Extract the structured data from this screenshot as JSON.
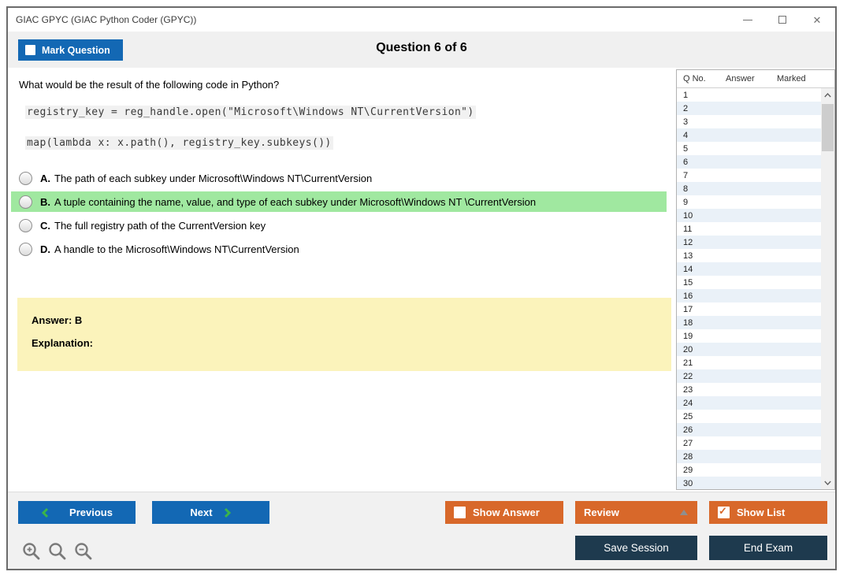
{
  "window": {
    "title": "GIAC GPYC (GIAC Python Coder (GPYC))"
  },
  "header": {
    "mark_question_label": "Mark Question",
    "question_counter": "Question 6 of 6"
  },
  "question": {
    "prompt": "What would be the result of the following code in Python?",
    "code_lines": [
      "registry_key = reg_handle.open(\"Microsoft\\Windows NT\\CurrentVersion\")",
      "map(lambda x: x.path(), registry_key.subkeys())"
    ],
    "options": [
      {
        "letter": "A.",
        "text": "The path of each subkey under Microsoft\\Windows NT\\CurrentVersion",
        "highlighted": false
      },
      {
        "letter": "B.",
        "text": "A tuple containing the name, value, and type of each subkey under Microsoft\\Windows NT \\CurrentVersion",
        "highlighted": true
      },
      {
        "letter": "C.",
        "text": "The full registry path of the CurrentVersion key",
        "highlighted": false
      },
      {
        "letter": "D.",
        "text": "A handle to the Microsoft\\Windows NT\\CurrentVersion",
        "highlighted": false
      }
    ]
  },
  "answer_box": {
    "answer_label": "Answer: B",
    "explanation_label": "Explanation:"
  },
  "question_list": {
    "columns": [
      "Q No.",
      "Answer",
      "Marked"
    ],
    "rows": [
      "1",
      "2",
      "3",
      "4",
      "5",
      "6",
      "7",
      "8",
      "9",
      "10",
      "11",
      "12",
      "13",
      "14",
      "15",
      "16",
      "17",
      "18",
      "19",
      "20",
      "21",
      "22",
      "23",
      "24",
      "25",
      "26",
      "27",
      "28",
      "29",
      "30"
    ]
  },
  "footer": {
    "previous_label": "Previous",
    "next_label": "Next",
    "show_answer_label": "Show Answer",
    "review_label": "Review",
    "show_list_label": "Show List",
    "save_session_label": "Save Session",
    "end_exam_label": "End Exam"
  },
  "icons": {
    "zoom_in": "zoom-in-icon",
    "zoom_reset": "magnifier-icon",
    "zoom_out": "zoom-out-icon"
  },
  "colors": {
    "accent_blue": "#1368b4",
    "accent_orange": "#d8682a",
    "accent_navy": "#1e3a4e",
    "highlight_green": "#a0e8a0",
    "answer_yellow": "#fbf3bb",
    "row_alt_blue": "#eaf1f8",
    "chevron_green": "#3bb44a"
  }
}
